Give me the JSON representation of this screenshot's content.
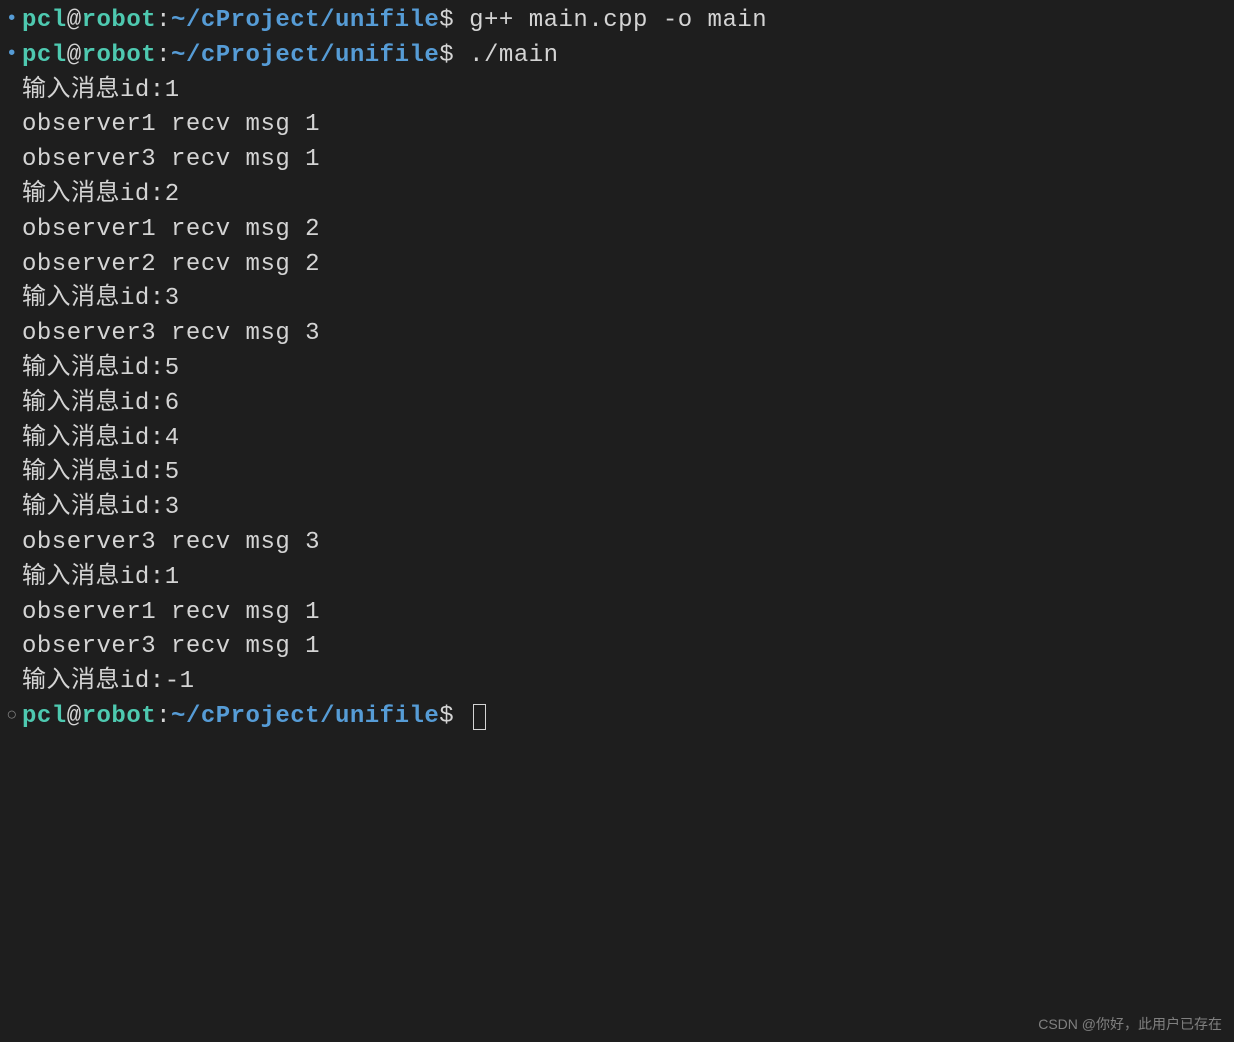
{
  "prompt": {
    "user": "pcl",
    "host": "robot",
    "path": "~/cProject/unifile",
    "dollar": "$"
  },
  "lines": [
    {
      "type": "prompt",
      "bullet": "filled",
      "command": "g++ main.cpp -o main"
    },
    {
      "type": "prompt",
      "bullet": "filled",
      "command": "./main"
    },
    {
      "type": "output",
      "text": "输入消息id:1"
    },
    {
      "type": "output",
      "text": "observer1 recv msg 1"
    },
    {
      "type": "output",
      "text": "observer3 recv msg 1"
    },
    {
      "type": "output",
      "text": "输入消息id:2"
    },
    {
      "type": "output",
      "text": "observer1 recv msg 2"
    },
    {
      "type": "output",
      "text": "observer2 recv msg 2"
    },
    {
      "type": "output",
      "text": "输入消息id:3"
    },
    {
      "type": "output",
      "text": "observer3 recv msg 3"
    },
    {
      "type": "output",
      "text": "输入消息id:5"
    },
    {
      "type": "output",
      "text": "输入消息id:6"
    },
    {
      "type": "output",
      "text": "输入消息id:4"
    },
    {
      "type": "output",
      "text": "输入消息id:5"
    },
    {
      "type": "output",
      "text": "输入消息id:3"
    },
    {
      "type": "output",
      "text": "observer3 recv msg 3"
    },
    {
      "type": "output",
      "text": "输入消息id:1"
    },
    {
      "type": "output",
      "text": "observer1 recv msg 1"
    },
    {
      "type": "output",
      "text": "observer3 recv msg 1"
    },
    {
      "type": "output",
      "text": "输入消息id:-1"
    },
    {
      "type": "prompt",
      "bullet": "hollow",
      "command": "",
      "cursor": true
    }
  ],
  "watermark": "CSDN @你好，此用户已存在"
}
